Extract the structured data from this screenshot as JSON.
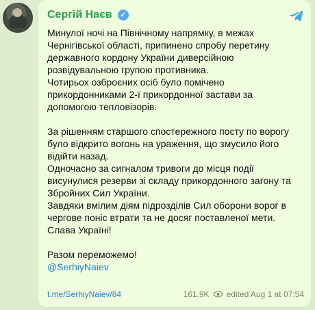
{
  "post": {
    "author": "Сергій Наєв",
    "verified_icon": "check-icon",
    "share_icon": "telegram-share-icon",
    "lines": [
      "Минулої ночі на Північному напрямку, в межах",
      "Чернігівської області, припинено спробу перетину",
      "державного кордону України диверсійною",
      "розвідувальною групою противника.",
      "Чотирьох озброєних осіб було помічено",
      "прикордонниками 2-ї прикордонної застави за",
      "допомогою тепловізорів.",
      "",
      "За рішенням старшого спостережного посту по ворогу",
      "було відкрито вогонь на ураження, що змусило його",
      "відійти назад.",
      "Одночасно за сигналом тривоги до місця події",
      "висунулися резерви зі складу прикордонного загону та",
      "Збройних Сил України.",
      "Завдяки вмілим діям підрозділів Сил оборони ворог в",
      "чергове поніс втрати та не досяг поставленої мети.",
      "Слава Україні!",
      "",
      "Разом переможемо!"
    ],
    "mention": "@SerhiyNaiev",
    "link": "t.me/SerhiyNaiev/84",
    "views": "161.9K",
    "meta": "edited  Aug 1 at 07:54",
    "colors": {
      "accent": "#2f9b4f",
      "link": "#1e7ec8",
      "verified": "#56a8ea",
      "background": "#effdde"
    }
  }
}
